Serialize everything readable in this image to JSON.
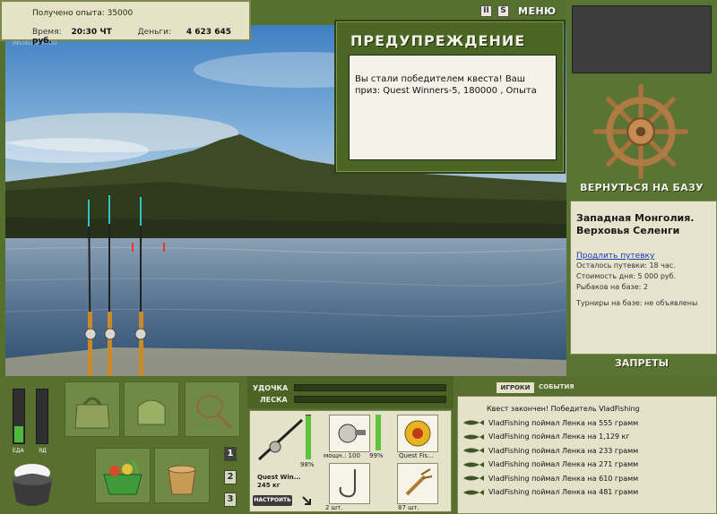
{
  "info": {
    "exp_line": "Получено опыта: 35000",
    "time_label": "Время:",
    "time_value": "20:30 ЧТ",
    "money_label": "Деньги:",
    "money_value": "4 623 645 руб."
  },
  "top_icons": {
    "pause": "II",
    "sound": "S",
    "menu": "МЕНЮ"
  },
  "watermark": "INSTALLSOFT.RU",
  "warning": {
    "title": "ПРЕДУПРЕЖДЕНИЕ",
    "message": "Вы стали победителем квеста! Ваш приз: Quest Winners-5, 180000 , Опыта"
  },
  "right": {
    "return_label": "ВЕРНУТЬСЯ НА БАЗУ",
    "location_name": "Западная Монголия. Верховья Селенги",
    "extend_link": "Продлить путевку",
    "trip_left": "Осталось путевки: 18 час.",
    "day_cost": "Стоимость дня: 5 000 руб.",
    "fishers": "Рыбаков на базе: 2",
    "tournaments": "Турниры на базе: не объявлены",
    "forbid_label": "ЗАПРЕТЫ"
  },
  "gauges": {
    "food_label": "ЕДА",
    "poison_label": "ЯД",
    "food_level": 0.3,
    "poison_level": 0
  },
  "pages": [
    "1",
    "2",
    "3"
  ],
  "tackle": {
    "rod_label": "УДОЧКА",
    "line_label": "ЛЕСКА",
    "rod_pct": "98%",
    "rod_name": "Quest Win...",
    "rod_weight": "245 кг",
    "reel_power": "мощн.: 100",
    "reel_pct": "99%",
    "line_name": "Quest Fis...",
    "hook_count": "2 шт.",
    "lure_count": "87 шт.",
    "adjust_label": "НАСТРОИТЬ"
  },
  "log": {
    "tab_players": "ИГРОКИ",
    "tab_events": "СОБЫТИЯ",
    "header": "Квест закончен! Победитель VladFishing",
    "rows": [
      "VladFishing поймал Ленка на 555 грамм",
      "VladFishing поймал Ленка на 1,129 кг",
      "VladFishing поймал Ленка на 233 грамм",
      "VladFishing поймал Ленка на 271 грамм",
      "VladFishing поймал Ленка на 610 грамм",
      "VladFishing поймал Ленка на 481 грамм"
    ]
  },
  "colors": {
    "panel_green": "#55702e",
    "dialog_green": "#4a6524",
    "paper": "#e5e2ca",
    "gauge_green": "#4dbb3a"
  }
}
